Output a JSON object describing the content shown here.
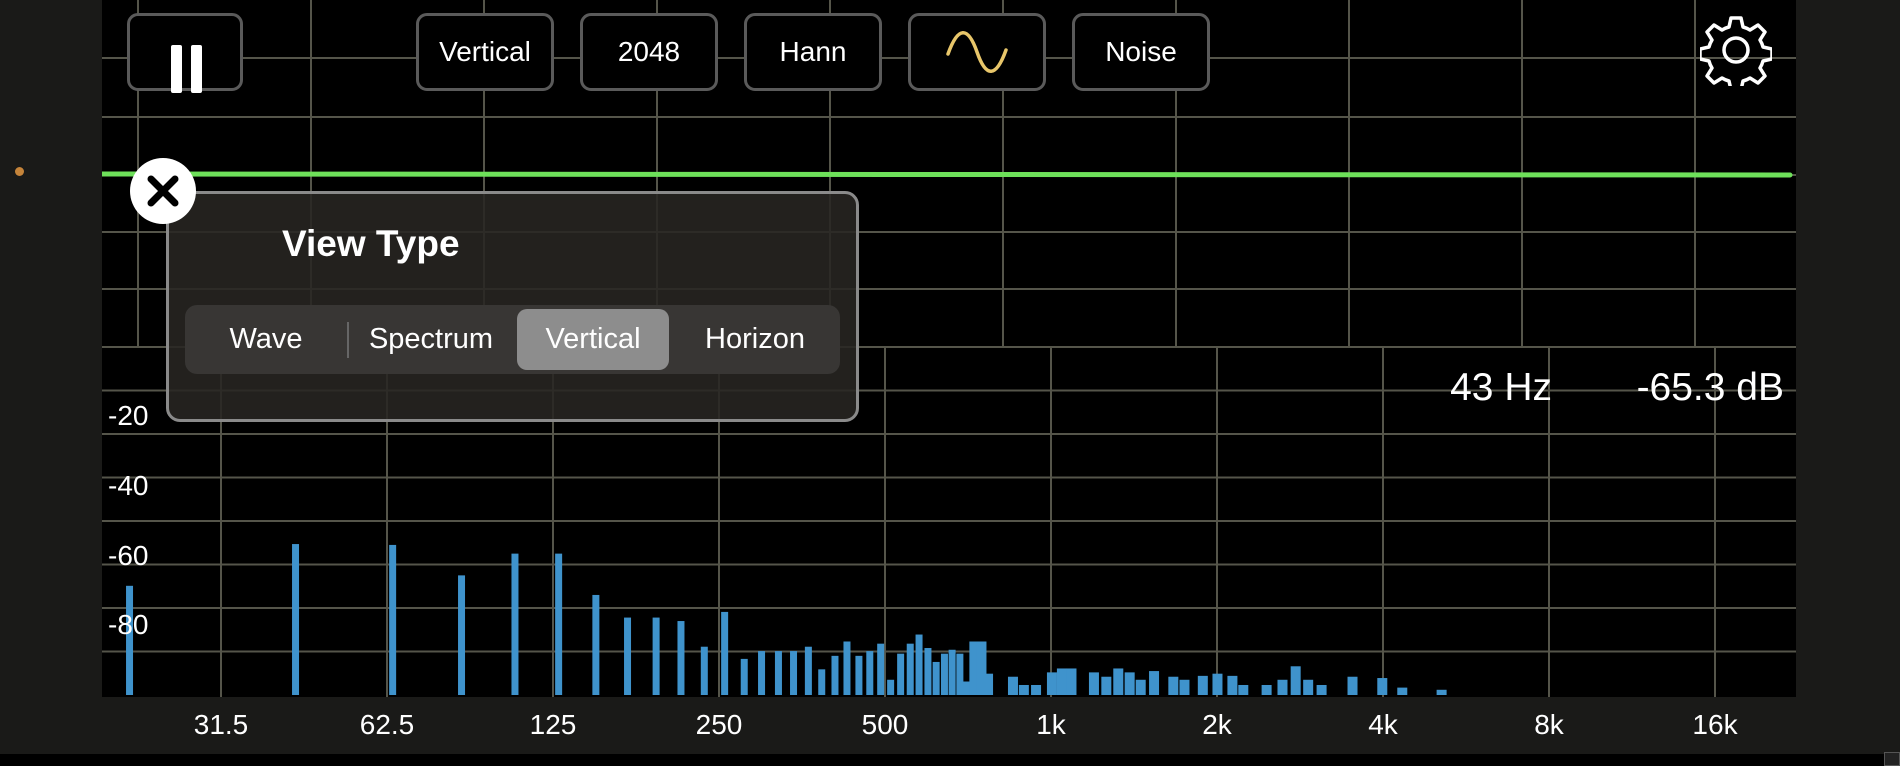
{
  "toolbar": {
    "pause_label": "Pause",
    "buttons": [
      {
        "label": "Vertical",
        "active": true
      },
      {
        "label": "2048",
        "active": false
      },
      {
        "label": "Hann",
        "active": false
      },
      {
        "label": "",
        "icon": "sine-wave-icon",
        "active": false
      },
      {
        "label": "Noise",
        "active": false
      }
    ],
    "settings_icon": "gear-icon"
  },
  "readout": {
    "frequency": "43 Hz",
    "level": "-65.3 dB"
  },
  "view_type_panel": {
    "title": "View Type",
    "options": [
      "Wave",
      "Spectrum",
      "Vertical",
      "Horizon"
    ],
    "selected": "Vertical",
    "close_icon": "close-icon"
  },
  "colors": {
    "background": "#000000",
    "grid": "#55554a",
    "trace": "#6ee05a",
    "bars": "#3f93cc",
    "sine_icon": "#e8c66a"
  },
  "chart_data": {
    "type": "bar",
    "x_scale": "log",
    "x_tick_labels": [
      "31.5",
      "62.5",
      "125",
      "250",
      "500",
      "1k",
      "2k",
      "4k",
      "8k",
      "16k"
    ],
    "y_tick_labels": [
      "-20",
      "-40",
      "-60",
      "-80"
    ],
    "ylim": [
      -100,
      -20
    ],
    "ylabel": "",
    "xlabel": "",
    "grid": true,
    "trace_level": 0.845,
    "bars": [
      {
        "x": 21.5,
        "y": -74.9
      },
      {
        "x": 43,
        "y": -65.3
      },
      {
        "x": 64.5,
        "y": -65.5
      },
      {
        "x": 86,
        "y": -72.5
      },
      {
        "x": 107.5,
        "y": -67.5
      },
      {
        "x": 129,
        "y": -67.5
      },
      {
        "x": 150.7,
        "y": -77.0
      },
      {
        "x": 172,
        "y": -82.2
      },
      {
        "x": 193.8,
        "y": -82.2
      },
      {
        "x": 215,
        "y": -83.0
      },
      {
        "x": 237,
        "y": -88.9
      },
      {
        "x": 258,
        "y": -80.9
      },
      {
        "x": 280,
        "y": -91.7
      },
      {
        "x": 301,
        "y": -89.9
      },
      {
        "x": 323,
        "y": -89.9
      },
      {
        "x": 344,
        "y": -89.9
      },
      {
        "x": 366,
        "y": -88.9
      },
      {
        "x": 387,
        "y": -94.1
      },
      {
        "x": 409,
        "y": -91.0
      },
      {
        "x": 430,
        "y": -87.7
      },
      {
        "x": 452,
        "y": -91.0
      },
      {
        "x": 473,
        "y": -89.9
      },
      {
        "x": 495,
        "y": -88.2
      },
      {
        "x": 516,
        "y": -96.5
      },
      {
        "x": 538,
        "y": -90.5
      },
      {
        "x": 560,
        "y": -88.2
      },
      {
        "x": 581,
        "y": -86.1
      },
      {
        "x": 603,
        "y": -89.2
      },
      {
        "x": 624,
        "y": -92.4
      },
      {
        "x": 646,
        "y": -90.5
      },
      {
        "x": 667,
        "y": -89.6
      },
      {
        "x": 689,
        "y": -90.5
      },
      {
        "x": 711,
        "y": -96.9
      },
      {
        "x": 732,
        "y": -87.7
      },
      {
        "x": 754,
        "y": -87.7
      },
      {
        "x": 775,
        "y": -95.1
      },
      {
        "x": 860,
        "y": -95.8
      },
      {
        "x": 900,
        "y": -97.7
      },
      {
        "x": 947,
        "y": -97.7
      },
      {
        "x": 1012,
        "y": -94.8
      },
      {
        "x": 1055,
        "y": -93.9
      },
      {
        "x": 1098,
        "y": -93.9
      },
      {
        "x": 1206,
        "y": -94.8
      },
      {
        "x": 1270,
        "y": -95.8
      },
      {
        "x": 1335,
        "y": -93.9
      },
      {
        "x": 1400,
        "y": -94.8
      },
      {
        "x": 1466,
        "y": -96.5
      },
      {
        "x": 1550,
        "y": -94.5
      },
      {
        "x": 1680,
        "y": -95.8
      },
      {
        "x": 1760,
        "y": -96.5
      },
      {
        "x": 1900,
        "y": -95.6
      },
      {
        "x": 2020,
        "y": -95.1
      },
      {
        "x": 2150,
        "y": -95.6
      },
      {
        "x": 2250,
        "y": -97.7
      },
      {
        "x": 2480,
        "y": -97.7
      },
      {
        "x": 2650,
        "y": -96.5
      },
      {
        "x": 2800,
        "y": -93.4
      },
      {
        "x": 2950,
        "y": -96.5
      },
      {
        "x": 3120,
        "y": -97.7
      },
      {
        "x": 3550,
        "y": -95.8
      },
      {
        "x": 4020,
        "y": -96.1
      },
      {
        "x": 4370,
        "y": -98.3
      },
      {
        "x": 5150,
        "y": -98.8
      }
    ]
  }
}
